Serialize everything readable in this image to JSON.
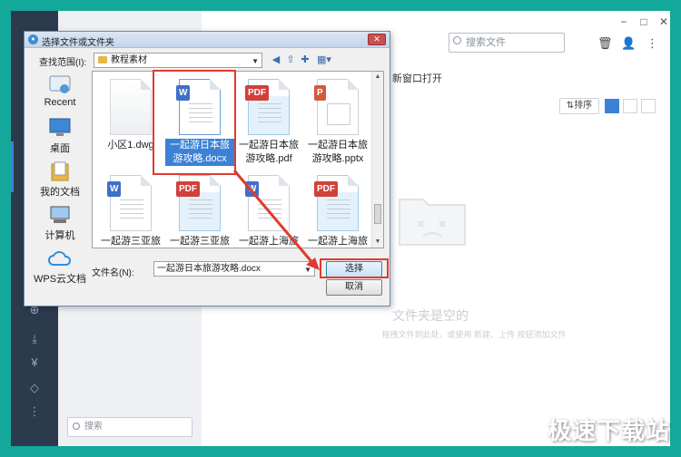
{
  "app": {
    "search_placeholder": "搜索文件",
    "open_new_window": "新窗口打开",
    "sort_label": "排序",
    "empty_title": "文件夹是空的",
    "empty_hint": "拖拽文件到此处，或使用 新建、上传 按钮添加文件",
    "bottom_search_placeholder": "搜索",
    "window_controls": [
      "−",
      "□",
      "✕"
    ]
  },
  "dialog": {
    "title": "选择文件或文件夹",
    "lookin_label": "查找范围(I):",
    "lookin_value": "教程素材",
    "places": [
      {
        "label": "Recent",
        "icon": "recent-icon"
      },
      {
        "label": "桌面",
        "icon": "desktop-icon"
      },
      {
        "label": "我的文档",
        "icon": "documents-icon"
      },
      {
        "label": "计算机",
        "icon": "computer-icon"
      },
      {
        "label": "WPS云文档",
        "icon": "cloud-icon"
      }
    ],
    "files": [
      {
        "line1": "小区1.dwg",
        "line2": "",
        "type": "dwg"
      },
      {
        "line1": "一起游日本旅",
        "line2": "游攻略.docx",
        "type": "docx",
        "selected": true
      },
      {
        "line1": "一起游日本旅",
        "line2": "游攻略.pdf",
        "type": "pdf"
      },
      {
        "line1": "一起游日本旅",
        "line2": "游攻略.pptx",
        "type": "pptx"
      },
      {
        "line1": "一起游三亚旅",
        "line2": "",
        "type": "docx"
      },
      {
        "line1": "一起游三亚旅",
        "line2": "",
        "type": "pdf"
      },
      {
        "line1": "一起游上海旅",
        "line2": "",
        "type": "docx"
      },
      {
        "line1": "一起游上海旅",
        "line2": "",
        "type": "pdf"
      }
    ],
    "badges": {
      "w": "W",
      "pdf": "PDF",
      "p": "P"
    },
    "filename_label": "文件名(N):",
    "filename_value": "一起游日本旅游攻略.docx",
    "select_button": "选择",
    "cancel_button": "取消",
    "close_glyph": "✕"
  },
  "watermark": "极速下载站",
  "colors": {
    "background": "#14a89b",
    "accent": "#3b82d6",
    "highlight": "#e03a2f"
  }
}
